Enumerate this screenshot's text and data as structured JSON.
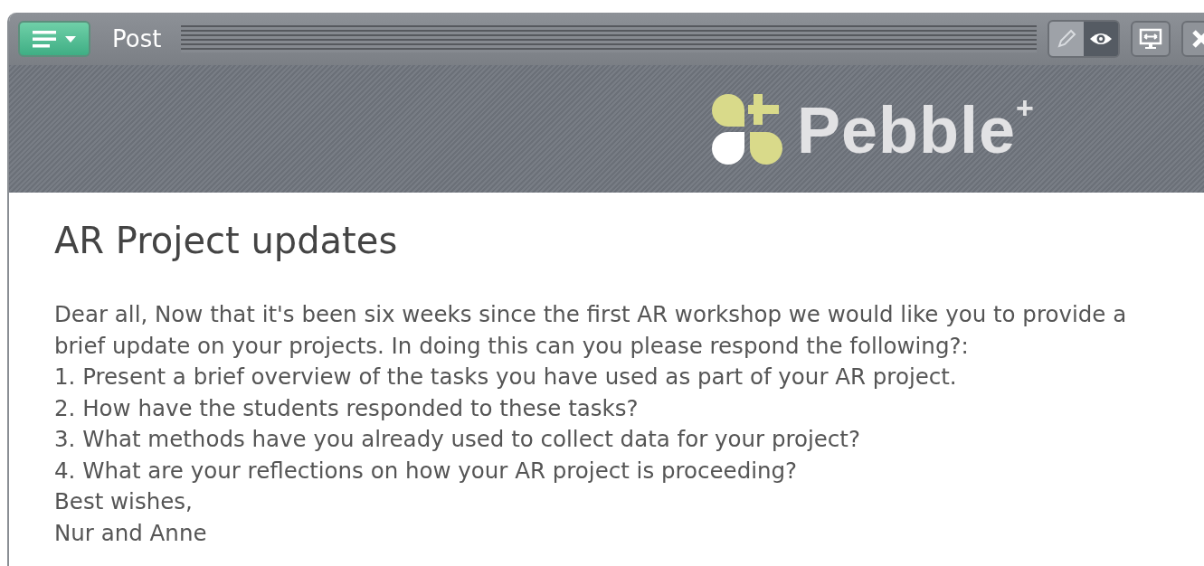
{
  "window": {
    "title": "Post"
  },
  "modes": [
    {
      "kind": "edit",
      "selected": false
    },
    {
      "kind": "view",
      "selected": true
    }
  ],
  "logo": {
    "text": "Pebble$^{+}$"
  },
  "post": {
    "title": "AR Project updates",
    "lines": [
      "Dear all, Now that it's been six weeks since the first AR workshop we would like you to provide a brief update on your projects. In doing this can you please respond the following?:",
      "1. Present a brief overview of the tasks you have used as part of your AR project.",
      "2. How have the students responded to these tasks?",
      "3. What methods have you already used to collect data for your project?",
      "4. What are your reflections on how your AR project is proceeding?",
      "Best wishes,",
      "Nur and Anne"
    ]
  }
}
